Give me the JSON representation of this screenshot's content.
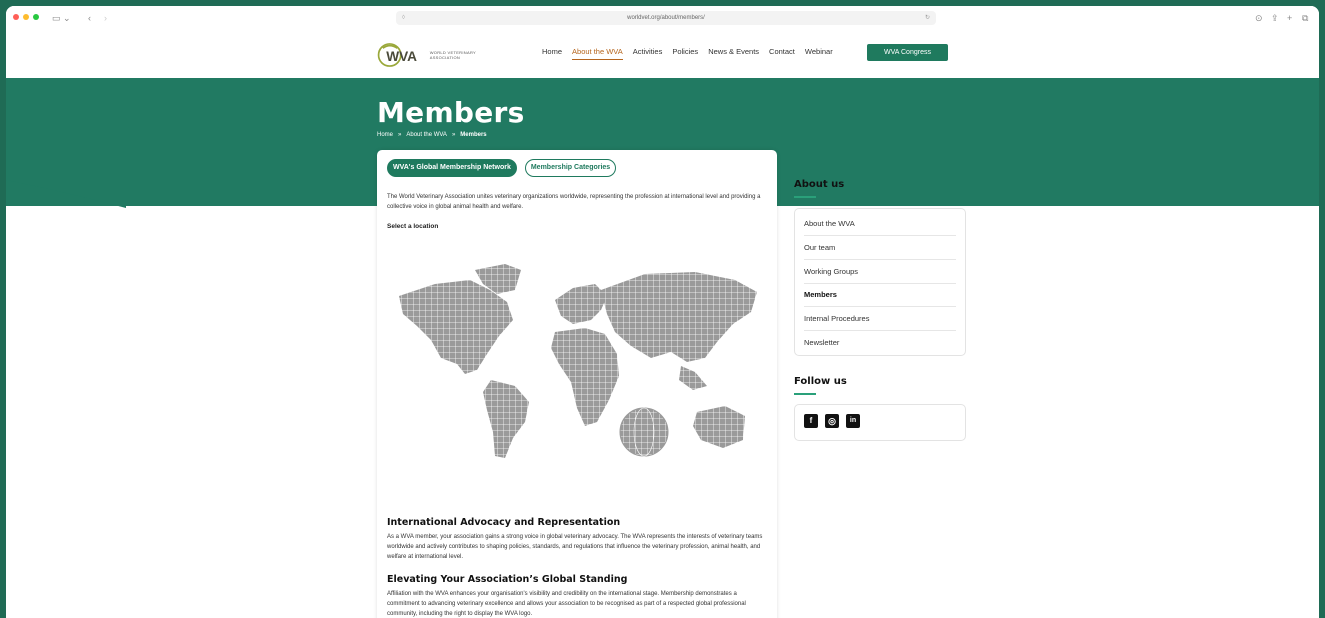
{
  "browser": {
    "url": "worldvet.org/about/members/"
  },
  "header": {
    "logo_text": "WORLD VETERINARY ASSOCIATION",
    "nav": [
      {
        "label": "Home"
      },
      {
        "label": "About the WVA",
        "active": true
      },
      {
        "label": "Activities"
      },
      {
        "label": "Policies"
      },
      {
        "label": "News & Events"
      },
      {
        "label": "Contact"
      },
      {
        "label": "Webinar"
      }
    ],
    "cta_label": "WVA Congress"
  },
  "hero": {
    "title": "Members",
    "breadcrumb": [
      "Home",
      "About the WVA",
      "Members"
    ],
    "separator": "»"
  },
  "main": {
    "tabs": [
      {
        "label": "WVA's Global Membership Network",
        "active": true
      },
      {
        "label": "Membership Categories",
        "active": false
      }
    ],
    "intro": "The World Veterinary Association unites veterinary organizations worldwide, representing the profession at international level and providing a collective voice in global animal health and welfare.",
    "select_label": "Select a location",
    "sections": [
      {
        "heading": "International Advocacy and Representation",
        "body": "As a WVA member, your association gains a strong voice in global veterinary advocacy. The WVA represents the interests of veterinary teams worldwide and actively contributes to shaping policies, standards, and regulations that influence the veterinary profession, animal health, and welfare at international level."
      },
      {
        "heading": "Elevating Your Association’s Global Standing",
        "body": "Affiliation with the WVA enhances your organisation's visibility and credibility on the international stage. Membership demonstrates a commitment to advancing veterinary excellence and allows your association to be recognised as part of a respected global professional community, including the right to display the WVA logo."
      }
    ]
  },
  "sidebar": {
    "about_heading": "About us",
    "about_items": [
      {
        "label": "About the WVA"
      },
      {
        "label": "Our team"
      },
      {
        "label": "Working Groups"
      },
      {
        "label": "Members",
        "current": true
      },
      {
        "label": "Internal Procedures"
      },
      {
        "label": "Newsletter"
      }
    ],
    "follow_heading": "Follow us",
    "socials": [
      {
        "name": "facebook",
        "glyph": "f"
      },
      {
        "name": "instagram",
        "glyph": "◎"
      },
      {
        "name": "linkedin",
        "glyph": "in"
      }
    ]
  },
  "colors": {
    "brand_green": "#217a62",
    "accent_orange": "#b5651d",
    "outer_frame": "#1f6b55"
  }
}
